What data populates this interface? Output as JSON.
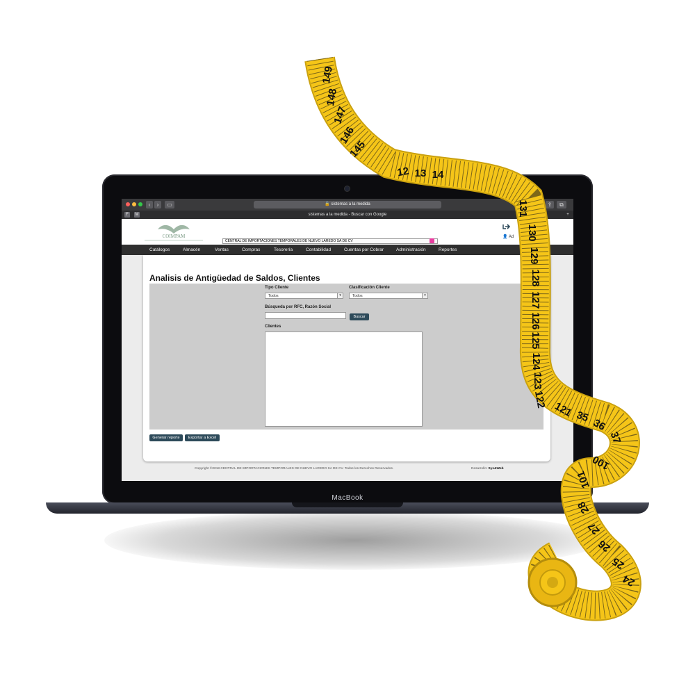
{
  "device": {
    "brand": "MacBook"
  },
  "browser": {
    "url_text": "sistemas a la medida",
    "tab_title": "sistemas a la medida - Buscar con Google"
  },
  "site": {
    "logo_text": "COIMPAM",
    "company_name": "CENTRAL DE IMPORTACIONES TEMPORALES DE NUEVO LAREDO SA DE CV",
    "user_label": "Ad",
    "menu": [
      "Catálogos",
      "Almacén",
      "Ventas",
      "Compras",
      "Tesorería",
      "Contabilidad",
      "Cuentas por Cobrar",
      "Administración",
      "Reportes"
    ]
  },
  "page": {
    "title": "Analisis de Antigüedad de Saldos, Clientes",
    "tipo_cliente": {
      "label": "Tipo Cliente",
      "value": "Todos"
    },
    "clasificacion_cliente": {
      "label": "Clasificación Cliente",
      "value": "Todos"
    },
    "busqueda": {
      "label": "Búsqueda por RFC, Razón Social",
      "value": "",
      "button": "Buscar"
    },
    "clientes": {
      "label": "Clientes"
    },
    "actions": {
      "generar": "Generar reporte",
      "exportar": "Exportar a Excel"
    }
  },
  "footer": {
    "copyright": "Copyright ©2018 CENTRAL DE IMPORTACIONES TEMPORALES DE NUEVO LAREDO SA DE CV. Todos los Derechos Reservados.",
    "developer_prefix": "Desarrollo:",
    "developer_name": "Sys&Web"
  },
  "tape": {
    "numbers": [
      "149",
      "148",
      "147",
      "146",
      "145",
      "12",
      "13",
      "14",
      "131",
      "130",
      "129",
      "128",
      "127",
      "126",
      "125",
      "124",
      "123",
      "122",
      "121",
      "35",
      "36",
      "37",
      "100",
      "101",
      "28",
      "27",
      "26",
      "25",
      "24"
    ]
  },
  "colors": {
    "menu_bg": "#2f2f2f",
    "button_bg": "#2d4a5a",
    "panel_bg": "#cccccc",
    "tape_yellow": "#f5c518",
    "accent_pink": "#e83fa0"
  }
}
